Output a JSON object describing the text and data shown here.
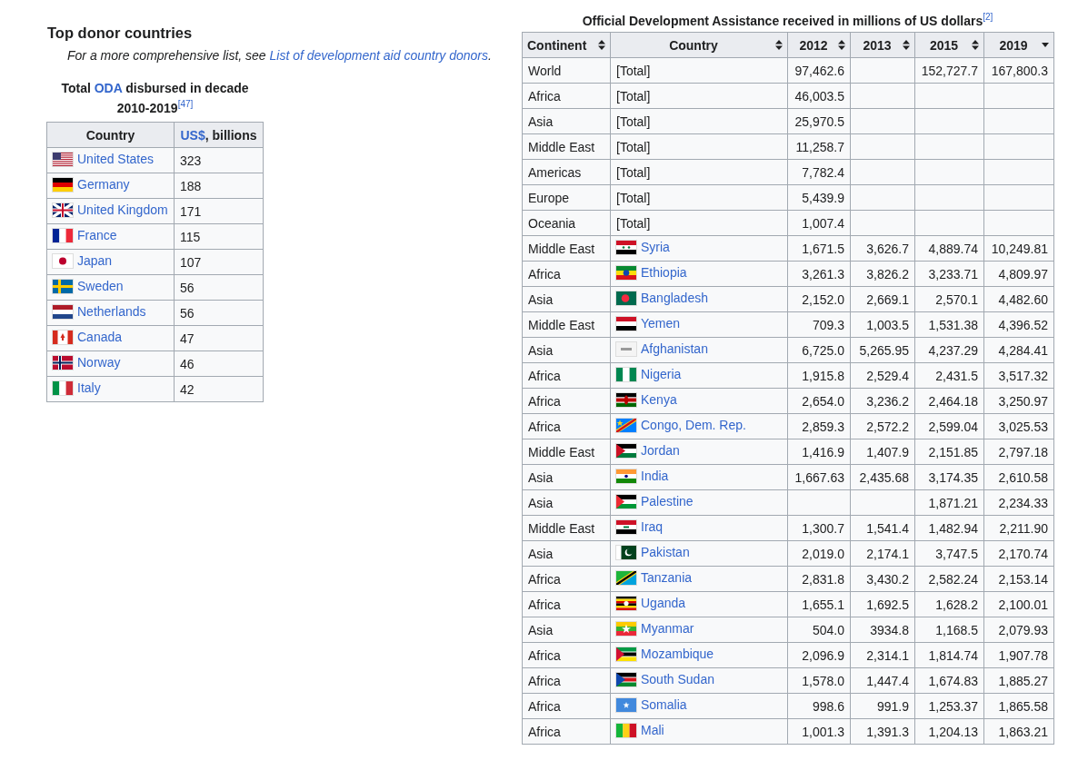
{
  "donors": {
    "heading": "Top donor countries",
    "hatnote": {
      "text": "For a more comprehensive list, see ",
      "link": "List of development aid country donors",
      "end": "."
    },
    "caption": {
      "before": "Total ",
      "link": "ODA",
      "after": " disbursed in decade 2010-2019",
      "ref": "[47]"
    },
    "columns": [
      {
        "text": "Country"
      },
      {
        "link": "US$",
        "text": ", billions"
      }
    ],
    "rows": [
      {
        "country": "United States",
        "kind": "us",
        "value": "323"
      },
      {
        "country": "Germany",
        "kind": "de",
        "value": "188"
      },
      {
        "country": "United Kingdom",
        "kind": "gb",
        "value": "171"
      },
      {
        "country": "France",
        "kind": "fr",
        "value": "115"
      },
      {
        "country": "Japan",
        "kind": "jp",
        "value": "107"
      },
      {
        "country": "Sweden",
        "kind": "se",
        "value": "56"
      },
      {
        "country": "Netherlands",
        "kind": "nl",
        "value": "56"
      },
      {
        "country": "Canada",
        "kind": "ca",
        "value": "47"
      },
      {
        "country": "Norway",
        "kind": "no",
        "value": "46"
      },
      {
        "country": "Italy",
        "kind": "it",
        "value": "42"
      }
    ]
  },
  "oda": {
    "title": "Official Development Assistance received in millions of US dollars",
    "ref": "[2]",
    "columns": [
      {
        "label": "Continent",
        "sorted": false
      },
      {
        "label": "Country",
        "sorted": false
      },
      {
        "label": "2012",
        "sorted": false
      },
      {
        "label": "2013",
        "sorted": false
      },
      {
        "label": "2015",
        "sorted": false
      },
      {
        "label": "2019",
        "sorted": true
      }
    ],
    "rows": [
      {
        "continent": "World",
        "country": "[Total]",
        "v2012": "97,462.6",
        "v2015": "152,727.7",
        "v2019": "167,800.3"
      },
      {
        "continent": "Africa",
        "country": "[Total]",
        "v2012": "46,003.5"
      },
      {
        "continent": "Asia",
        "country": "[Total]",
        "v2012": "25,970.5"
      },
      {
        "continent": "Middle East",
        "country": "[Total]",
        "v2012": "11,258.7"
      },
      {
        "continent": "Americas",
        "country": "[Total]",
        "v2012": "7,782.4"
      },
      {
        "continent": "Europe",
        "country": "[Total]",
        "v2012": "5,439.9"
      },
      {
        "continent": "Oceania",
        "country": "[Total]",
        "v2012": "1,007.4"
      },
      {
        "continent": "Middle East",
        "country": "Syria",
        "kind": "sy",
        "v2012": "1,671.5",
        "v2013": "3,626.7",
        "v2015": "4,889.74",
        "v2019": "10,249.81"
      },
      {
        "continent": "Africa",
        "country": "Ethiopia",
        "kind": "et",
        "v2012": "3,261.3",
        "v2013": "3,826.2",
        "v2015": "3,233.71",
        "v2019": "4,809.97"
      },
      {
        "continent": "Asia",
        "country": "Bangladesh",
        "kind": "bd",
        "v2012": "2,152.0",
        "v2013": "2,669.1",
        "v2015": "2,570.1",
        "v2019": "4,482.60"
      },
      {
        "continent": "Middle East",
        "country": "Yemen",
        "kind": "ye",
        "v2012": "709.3",
        "v2013": "1,003.5",
        "v2015": "1,531.38",
        "v2019": "4,396.52"
      },
      {
        "continent": "Asia",
        "country": "Afghanistan",
        "kind": "af",
        "v2012": "6,725.0",
        "v2013": "5,265.95",
        "v2015": "4,237.29",
        "v2019": "4,284.41"
      },
      {
        "continent": "Africa",
        "country": "Nigeria",
        "kind": "ng",
        "v2012": "1,915.8",
        "v2013": "2,529.4",
        "v2015": "2,431.5",
        "v2019": "3,517.32"
      },
      {
        "continent": "Africa",
        "country": "Kenya",
        "kind": "ke",
        "v2012": "2,654.0",
        "v2013": "3,236.2",
        "v2015": "2,464.18",
        "v2019": "3,250.97"
      },
      {
        "continent": "Africa",
        "country": "Congo, Dem. Rep.",
        "kind": "cd",
        "v2012": "2,859.3",
        "v2013": "2,572.2",
        "v2015": "2,599.04",
        "v2019": "3,025.53"
      },
      {
        "continent": "Middle East",
        "country": "Jordan",
        "kind": "jo",
        "v2012": "1,416.9",
        "v2013": "1,407.9",
        "v2015": "2,151.85",
        "v2019": "2,797.18"
      },
      {
        "continent": "Asia",
        "country": "India",
        "kind": "in",
        "v2012": "1,667.63",
        "v2013": "2,435.68",
        "v2015": "3,174.35",
        "v2019": "2,610.58"
      },
      {
        "continent": "Asia",
        "country": "Palestine",
        "kind": "ps",
        "v2015": "1,871.21",
        "v2019": "2,234.33"
      },
      {
        "continent": "Middle East",
        "country": "Iraq",
        "kind": "iq",
        "v2012": "1,300.7",
        "v2013": "1,541.4",
        "v2015": "1,482.94",
        "v2019": "2,211.90"
      },
      {
        "continent": "Asia",
        "country": "Pakistan",
        "kind": "pk",
        "v2012": "2,019.0",
        "v2013": "2,174.1",
        "v2015": "3,747.5",
        "v2019": "2,170.74"
      },
      {
        "continent": "Africa",
        "country": "Tanzania",
        "kind": "tz",
        "v2012": "2,831.8",
        "v2013": "3,430.2",
        "v2015": "2,582.24",
        "v2019": "2,153.14"
      },
      {
        "continent": "Africa",
        "country": "Uganda",
        "kind": "ug",
        "v2012": "1,655.1",
        "v2013": "1,692.5",
        "v2015": "1,628.2",
        "v2019": "2,100.01"
      },
      {
        "continent": "Asia",
        "country": "Myanmar",
        "kind": "mm",
        "v2012": "504.0",
        "v2013": "3934.8",
        "v2015": "1,168.5",
        "v2019": "2,079.93"
      },
      {
        "continent": "Africa",
        "country": "Mozambique",
        "kind": "mz",
        "v2012": "2,096.9",
        "v2013": "2,314.1",
        "v2015": "1,814.74",
        "v2019": "1,907.78"
      },
      {
        "continent": "Africa",
        "country": "South Sudan",
        "kind": "ss",
        "v2012": "1,578.0",
        "v2013": "1,447.4",
        "v2015": "1,674.83",
        "v2019": "1,885.27"
      },
      {
        "continent": "Africa",
        "country": "Somalia",
        "kind": "so",
        "v2012": "998.6",
        "v2013": "991.9",
        "v2015": "1,253.37",
        "v2019": "1,865.58"
      },
      {
        "continent": "Africa",
        "country": "Mali",
        "kind": "ml",
        "v2012": "1,001.3",
        "v2013": "1,391.3",
        "v2015": "1,204.13",
        "v2019": "1,863.21"
      }
    ]
  }
}
